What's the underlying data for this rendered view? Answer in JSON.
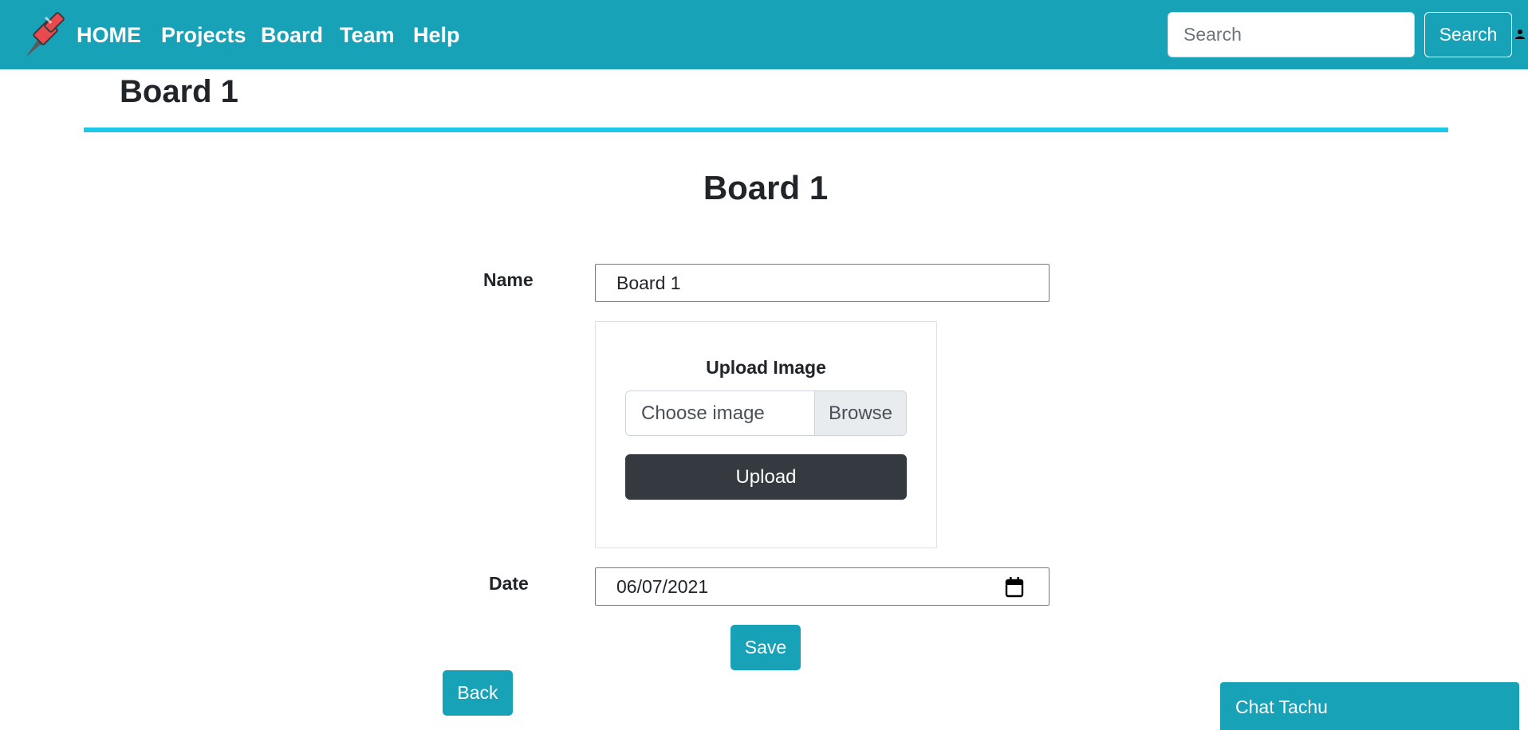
{
  "navbar": {
    "links": [
      "HOME",
      "Projects",
      "Board",
      "Team",
      "Help"
    ],
    "search_placeholder": "Search",
    "search_button": "Search",
    "background_color": "#17a2b8"
  },
  "page": {
    "title": "Board 1",
    "divider_color": "#1cc7e8"
  },
  "form": {
    "title": "Board 1",
    "name_label": "Name",
    "name_value": "Board 1",
    "upload": {
      "title": "Upload Image",
      "file_placeholder": "Choose image",
      "browse_label": "Browse",
      "upload_button": "Upload"
    },
    "date_label": "Date",
    "date_value": "06/07/2021",
    "save_button": "Save"
  },
  "back_button": "Back",
  "chat": {
    "label": "Chat Tachu"
  },
  "icons": {
    "logo": "pushpin-icon",
    "user": "user-icon",
    "calendar": "calendar-icon"
  }
}
